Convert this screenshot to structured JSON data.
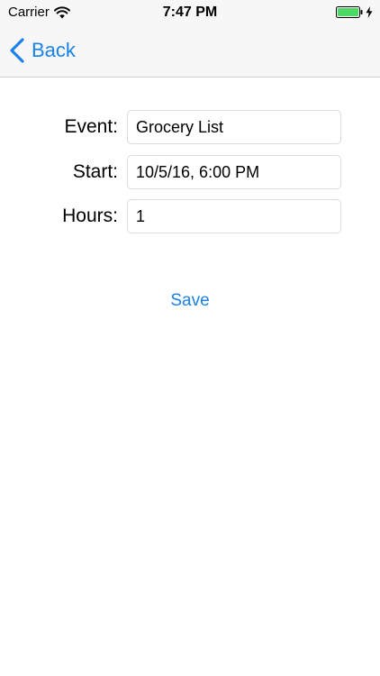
{
  "status_bar": {
    "carrier": "Carrier",
    "time": "7:47 PM"
  },
  "nav": {
    "back_label": "Back"
  },
  "form": {
    "event_label": "Event:",
    "event_value": "Grocery List",
    "start_label": "Start:",
    "start_value": "10/5/16, 6:00 PM",
    "hours_label": "Hours:",
    "hours_value": "1"
  },
  "actions": {
    "save_label": "Save"
  },
  "colors": {
    "accent": "#1a82e8",
    "battery": "#4cd964"
  },
  "icons": {
    "wifi": "wifi-icon",
    "battery": "battery-icon",
    "charging": "charging-bolt-icon",
    "back": "chevron-left-icon"
  }
}
